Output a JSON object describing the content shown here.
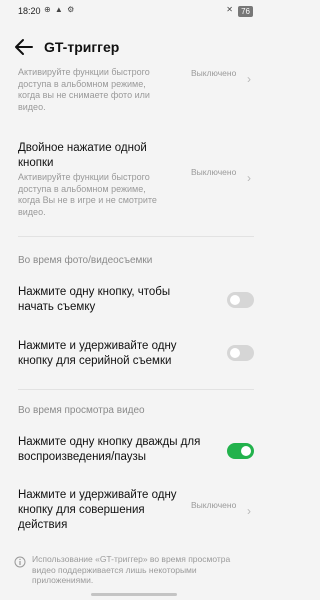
{
  "status_bar": {
    "time": "18:20",
    "icons_left": "⊕ ▲ ⚙",
    "icon_right": "✕",
    "battery": "76"
  },
  "header": {
    "title": "GT-триггер"
  },
  "rows": [
    {
      "title": "",
      "description": "Активируйте функции быстрого доступа в альбомном режиме, когда вы не снимаете фото или видео.",
      "value": "Выключено"
    },
    {
      "title": "Двойное нажатие одной кнопки",
      "description": "Активируйте функции быстрого доступа в альбомном режиме, когда Вы не в игре и не смотрите видео.",
      "value": "Выключено"
    }
  ],
  "sections": [
    {
      "label": "Во время фото/видеосъемки",
      "items": [
        {
          "title": "Нажмите одну кнопку, чтобы начать съемку",
          "enabled": false
        },
        {
          "title": "Нажмите и удерживайте одну кнопку для серийной съемки",
          "enabled": false
        }
      ]
    },
    {
      "label": "Во время просмотра видео",
      "items": [
        {
          "title": "Нажмите одну кнопку дважды для воспроизведения/паузы",
          "enabled": true
        },
        {
          "title": "Нажмите и удерживайте одну кнопку для совершения действия",
          "value": "Выключено"
        }
      ]
    }
  ],
  "footer": {
    "info_text": "Использование «GT-триггер» во время просмотра видео поддерживается лишь некоторыми приложениями."
  },
  "colors": {
    "toggle_on": "#22b24c",
    "toggle_off": "#d6d6d6",
    "background": "#f4f4f4"
  }
}
